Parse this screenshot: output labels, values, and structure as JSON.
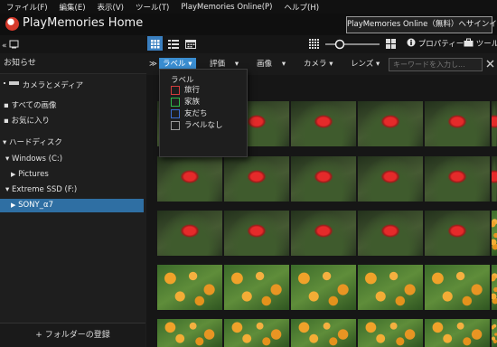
{
  "menubar": [
    "ファイル(F)",
    "編集(E)",
    "表示(V)",
    "ツール(T)",
    "PlayMemories Online(P)",
    "ヘルプ(H)"
  ],
  "app": {
    "title": "PlayMemories Home"
  },
  "online_signin": "PlayMemories Online（無料）へサインイン",
  "toolbar": {
    "properties": "プロパティー",
    "tools": "ツール"
  },
  "sidebar": {
    "header": "お知らせ",
    "camera_media": "カメラとメディア",
    "all_images": "すべての画像",
    "favorites": "お気に入り",
    "hard_disk": "ハードディスク",
    "windows_c": "Windows (C:)",
    "pictures": "Pictures",
    "extreme_ssd": "Extreme SSD (F:)",
    "sony_a7": "SONY_α7",
    "add_folder": "+ フォルダーの登録"
  },
  "filters": {
    "label": "ラベル",
    "rating": "評価",
    "image": "画像",
    "camera": "カメラ",
    "lens": "レンズ",
    "search_placeholder": "キーワードを入力し..."
  },
  "label_dropdown": {
    "title": "ラベル",
    "items": [
      {
        "text": "旅行",
        "color": "#d33b3b"
      },
      {
        "text": "家族",
        "color": "#2fb84a"
      },
      {
        "text": "友だち",
        "color": "#3b6ed3"
      },
      {
        "text": "ラベルなし",
        "color": "#9a9a9a"
      }
    ]
  },
  "grid_rows": [
    [
      "red",
      "red",
      "red",
      "red",
      "red",
      "red"
    ],
    [
      "red",
      "red",
      "red",
      "red",
      "red",
      "red"
    ],
    [
      "red",
      "red",
      "red",
      "red",
      "red",
      "orange"
    ],
    [
      "orange",
      "orange",
      "orange",
      "orange",
      "orange",
      "orange"
    ],
    [
      "orange",
      "orange",
      "orange",
      "orange",
      "orange",
      "orange"
    ]
  ]
}
